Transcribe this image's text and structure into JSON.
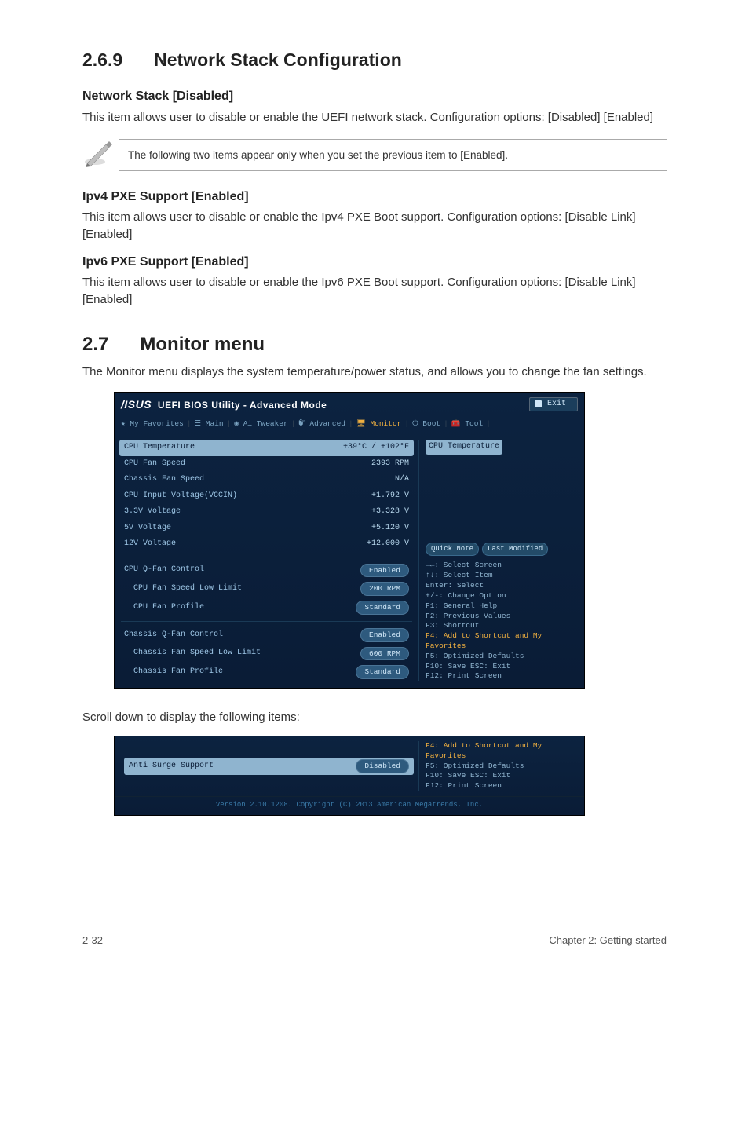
{
  "section269": {
    "number": "2.6.9",
    "title": "Network Stack Configuration",
    "items": [
      {
        "heading": "Network Stack [Disabled]",
        "body": "This item allows user to disable or enable the UEFI network stack. Configuration options: [Disabled] [Enabled]"
      }
    ],
    "note": "The following two items appear only when you set the previous item to [Enabled].",
    "after_note": [
      {
        "heading": "Ipv4 PXE Support [Enabled]",
        "body": "This item allows user to disable or enable the Ipv4 PXE Boot support. Configuration options: [Disable Link] [Enabled]"
      },
      {
        "heading": "Ipv6 PXE Support [Enabled]",
        "body": "This item allows user to disable or enable the Ipv6 PXE Boot support. Configuration options: [Disable Link] [Enabled]"
      }
    ]
  },
  "section27": {
    "number": "2.7",
    "title": "Monitor menu",
    "intro": "The Monitor menu displays the system temperature/power status, and allows you to change the fan settings."
  },
  "bios": {
    "brand": "/ISUS",
    "title": "UEFI BIOS Utility - Advanced Mode",
    "exit": "Exit",
    "tabs": {
      "fav": "★ My Favorites",
      "main": "Main",
      "tweaker": "Ai Tweaker",
      "advanced": "Advanced",
      "monitor": "Monitor",
      "boot": "Boot",
      "tool": "Tool"
    },
    "rows": [
      {
        "label": "CPU Temperature",
        "value": "+39°C / +102°F",
        "selected": true
      },
      {
        "label": "CPU Fan Speed",
        "value": "2393 RPM"
      },
      {
        "label": "Chassis Fan Speed",
        "value": "N/A"
      },
      {
        "label": "CPU Input Voltage(VCCIN)",
        "value": "+1.792 V"
      },
      {
        "label": "3.3V Voltage",
        "value": "+3.328 V"
      },
      {
        "label": "5V Voltage",
        "value": "+5.120 V"
      },
      {
        "label": "12V Voltage",
        "value": "+12.000 V"
      }
    ],
    "group2": [
      {
        "label": "CPU Q-Fan Control",
        "pill": "Enabled"
      },
      {
        "label": "CPU Fan Speed Low Limit",
        "pill": "200 RPM",
        "indent": true
      },
      {
        "label": "CPU Fan Profile",
        "pill": "Standard",
        "indent": true
      }
    ],
    "group3": [
      {
        "label": "Chassis Q-Fan Control",
        "pill": "Enabled"
      },
      {
        "label": "Chassis Fan Speed Low Limit",
        "pill": "600 RPM",
        "indent": true
      },
      {
        "label": "Chassis Fan Profile",
        "pill": "Standard",
        "indent": true
      }
    ],
    "right_label": "CPU Temperature",
    "right_buttons": {
      "quick": "Quick Note",
      "last": "Last Modified"
    },
    "help": [
      "→←: Select Screen",
      "↑↓: Select Item",
      "Enter: Select",
      "+/-: Change Option",
      "F1: General Help",
      "F2: Previous Values",
      "F3: Shortcut",
      "F4: Add to Shortcut and My Favorites",
      "F5: Optimized Defaults",
      "F10: Save  ESC: Exit",
      "F12: Print Screen"
    ]
  },
  "scroll_caption": "Scroll down to display the following items:",
  "bios2": {
    "row": {
      "label": "Anti Surge Support",
      "pill": "Disabled"
    },
    "help": [
      "F4: Add to Shortcut and My Favorites",
      "F5: Optimized Defaults",
      "F10: Save  ESC: Exit",
      "F12: Print Screen"
    ],
    "footer": "Version 2.10.1208. Copyright (C) 2013 American Megatrends, Inc."
  },
  "page_footer": {
    "left": "2-32",
    "right": "Chapter 2: Getting started"
  }
}
